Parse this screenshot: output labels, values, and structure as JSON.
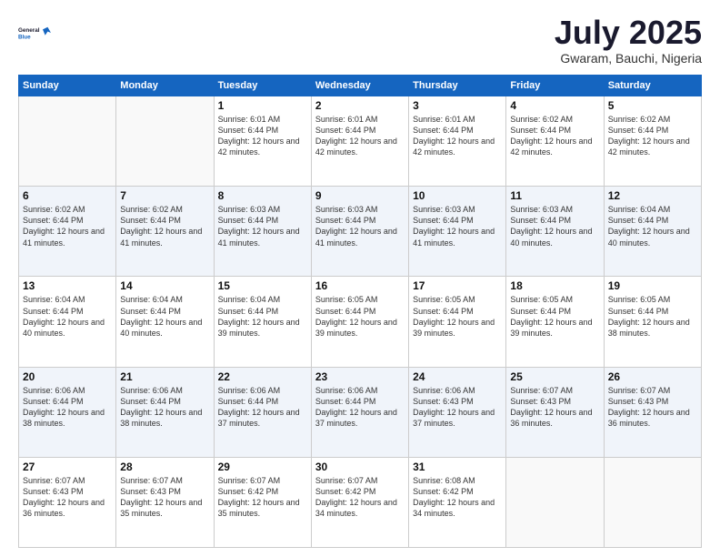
{
  "logo": {
    "line1": "General",
    "line2": "Blue"
  },
  "header": {
    "month_year": "July 2025",
    "location": "Gwaram, Bauchi, Nigeria"
  },
  "weekdays": [
    "Sunday",
    "Monday",
    "Tuesday",
    "Wednesday",
    "Thursday",
    "Friday",
    "Saturday"
  ],
  "weeks": [
    [
      {
        "day": "",
        "info": ""
      },
      {
        "day": "",
        "info": ""
      },
      {
        "day": "1",
        "info": "Sunrise: 6:01 AM\nSunset: 6:44 PM\nDaylight: 12 hours and 42 minutes."
      },
      {
        "day": "2",
        "info": "Sunrise: 6:01 AM\nSunset: 6:44 PM\nDaylight: 12 hours and 42 minutes."
      },
      {
        "day": "3",
        "info": "Sunrise: 6:01 AM\nSunset: 6:44 PM\nDaylight: 12 hours and 42 minutes."
      },
      {
        "day": "4",
        "info": "Sunrise: 6:02 AM\nSunset: 6:44 PM\nDaylight: 12 hours and 42 minutes."
      },
      {
        "day": "5",
        "info": "Sunrise: 6:02 AM\nSunset: 6:44 PM\nDaylight: 12 hours and 42 minutes."
      }
    ],
    [
      {
        "day": "6",
        "info": "Sunrise: 6:02 AM\nSunset: 6:44 PM\nDaylight: 12 hours and 41 minutes."
      },
      {
        "day": "7",
        "info": "Sunrise: 6:02 AM\nSunset: 6:44 PM\nDaylight: 12 hours and 41 minutes."
      },
      {
        "day": "8",
        "info": "Sunrise: 6:03 AM\nSunset: 6:44 PM\nDaylight: 12 hours and 41 minutes."
      },
      {
        "day": "9",
        "info": "Sunrise: 6:03 AM\nSunset: 6:44 PM\nDaylight: 12 hours and 41 minutes."
      },
      {
        "day": "10",
        "info": "Sunrise: 6:03 AM\nSunset: 6:44 PM\nDaylight: 12 hours and 41 minutes."
      },
      {
        "day": "11",
        "info": "Sunrise: 6:03 AM\nSunset: 6:44 PM\nDaylight: 12 hours and 40 minutes."
      },
      {
        "day": "12",
        "info": "Sunrise: 6:04 AM\nSunset: 6:44 PM\nDaylight: 12 hours and 40 minutes."
      }
    ],
    [
      {
        "day": "13",
        "info": "Sunrise: 6:04 AM\nSunset: 6:44 PM\nDaylight: 12 hours and 40 minutes."
      },
      {
        "day": "14",
        "info": "Sunrise: 6:04 AM\nSunset: 6:44 PM\nDaylight: 12 hours and 40 minutes."
      },
      {
        "day": "15",
        "info": "Sunrise: 6:04 AM\nSunset: 6:44 PM\nDaylight: 12 hours and 39 minutes."
      },
      {
        "day": "16",
        "info": "Sunrise: 6:05 AM\nSunset: 6:44 PM\nDaylight: 12 hours and 39 minutes."
      },
      {
        "day": "17",
        "info": "Sunrise: 6:05 AM\nSunset: 6:44 PM\nDaylight: 12 hours and 39 minutes."
      },
      {
        "day": "18",
        "info": "Sunrise: 6:05 AM\nSunset: 6:44 PM\nDaylight: 12 hours and 39 minutes."
      },
      {
        "day": "19",
        "info": "Sunrise: 6:05 AM\nSunset: 6:44 PM\nDaylight: 12 hours and 38 minutes."
      }
    ],
    [
      {
        "day": "20",
        "info": "Sunrise: 6:06 AM\nSunset: 6:44 PM\nDaylight: 12 hours and 38 minutes."
      },
      {
        "day": "21",
        "info": "Sunrise: 6:06 AM\nSunset: 6:44 PM\nDaylight: 12 hours and 38 minutes."
      },
      {
        "day": "22",
        "info": "Sunrise: 6:06 AM\nSunset: 6:44 PM\nDaylight: 12 hours and 37 minutes."
      },
      {
        "day": "23",
        "info": "Sunrise: 6:06 AM\nSunset: 6:44 PM\nDaylight: 12 hours and 37 minutes."
      },
      {
        "day": "24",
        "info": "Sunrise: 6:06 AM\nSunset: 6:43 PM\nDaylight: 12 hours and 37 minutes."
      },
      {
        "day": "25",
        "info": "Sunrise: 6:07 AM\nSunset: 6:43 PM\nDaylight: 12 hours and 36 minutes."
      },
      {
        "day": "26",
        "info": "Sunrise: 6:07 AM\nSunset: 6:43 PM\nDaylight: 12 hours and 36 minutes."
      }
    ],
    [
      {
        "day": "27",
        "info": "Sunrise: 6:07 AM\nSunset: 6:43 PM\nDaylight: 12 hours and 36 minutes."
      },
      {
        "day": "28",
        "info": "Sunrise: 6:07 AM\nSunset: 6:43 PM\nDaylight: 12 hours and 35 minutes."
      },
      {
        "day": "29",
        "info": "Sunrise: 6:07 AM\nSunset: 6:42 PM\nDaylight: 12 hours and 35 minutes."
      },
      {
        "day": "30",
        "info": "Sunrise: 6:07 AM\nSunset: 6:42 PM\nDaylight: 12 hours and 34 minutes."
      },
      {
        "day": "31",
        "info": "Sunrise: 6:08 AM\nSunset: 6:42 PM\nDaylight: 12 hours and 34 minutes."
      },
      {
        "day": "",
        "info": ""
      },
      {
        "day": "",
        "info": ""
      }
    ]
  ]
}
